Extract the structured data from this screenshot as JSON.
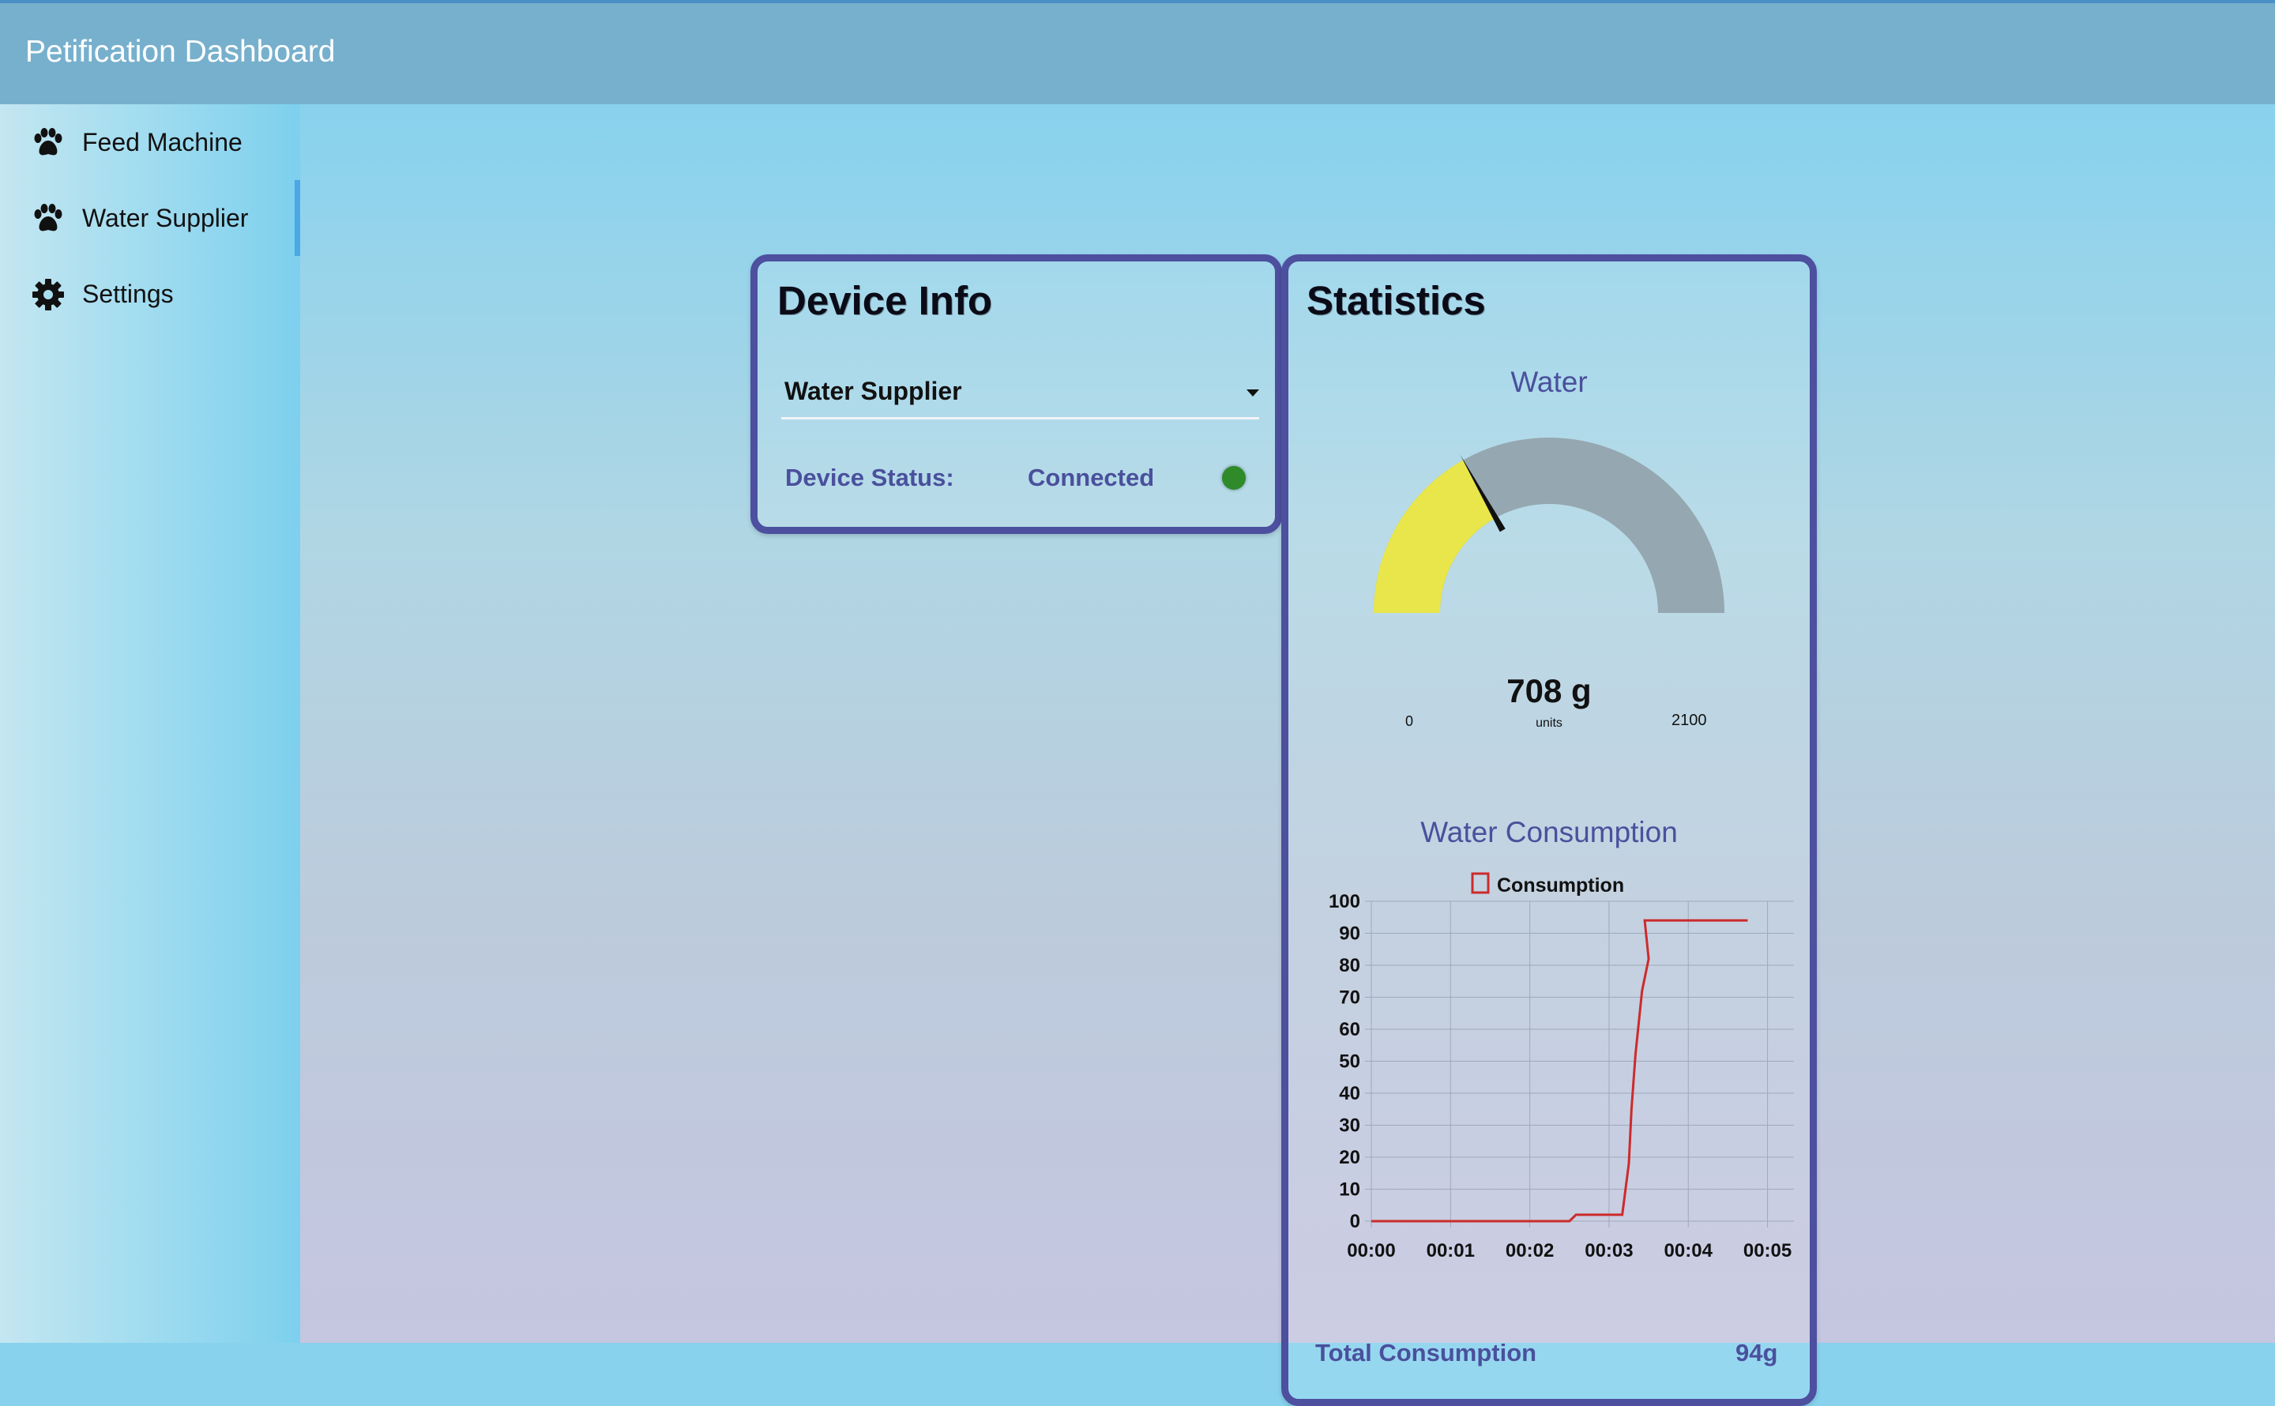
{
  "app": {
    "title": "Petification Dashboard"
  },
  "sidebar": {
    "items": [
      {
        "label": "Feed Machine",
        "icon": "paw-icon",
        "active": false
      },
      {
        "label": "Water Supplier",
        "icon": "paw-icon",
        "active": true
      },
      {
        "label": "Settings",
        "icon": "gear-icon",
        "active": false
      }
    ]
  },
  "device_info": {
    "title": "Device Info",
    "device_select": {
      "value": "Water Supplier"
    },
    "status_label": "Device Status:",
    "status_value": "Connected",
    "status_color": "#2f8b2a"
  },
  "statistics": {
    "title": "Statistics",
    "gauge": {
      "title": "Water",
      "value": 708,
      "value_text": "708 g",
      "units": "units",
      "min": 0,
      "max": 2100,
      "min_label": "0",
      "max_label": "2100",
      "fill_color": "#e8e64a",
      "track_color": "#95a7b0"
    },
    "chart_title": "Water Consumption",
    "total_label": "Total Consumption",
    "total_value": "94g"
  },
  "chart_data": {
    "type": "line",
    "title": "Water Consumption",
    "xlabel": "",
    "ylabel": "",
    "x_ticks": [
      "00:00",
      "00:01",
      "00:02",
      "00:03",
      "00:04",
      "00:05"
    ],
    "y_ticks": [
      0,
      10,
      20,
      30,
      40,
      50,
      60,
      70,
      80,
      90,
      100
    ],
    "xlim": [
      "00:00",
      "00:05:20"
    ],
    "ylim": [
      0,
      100
    ],
    "grid": true,
    "legend": "top-center",
    "series": [
      {
        "name": "Consumption",
        "color": "#cc2b2b",
        "x": [
          "00:00",
          "00:02:30",
          "00:02:35",
          "00:03:10",
          "00:03:15",
          "00:03:17",
          "00:03:20",
          "00:03:25",
          "00:03:30",
          "00:03:27",
          "00:04:45"
        ],
        "y": [
          0,
          0,
          2,
          2,
          18,
          35,
          52,
          72,
          82,
          94,
          94
        ]
      }
    ]
  }
}
